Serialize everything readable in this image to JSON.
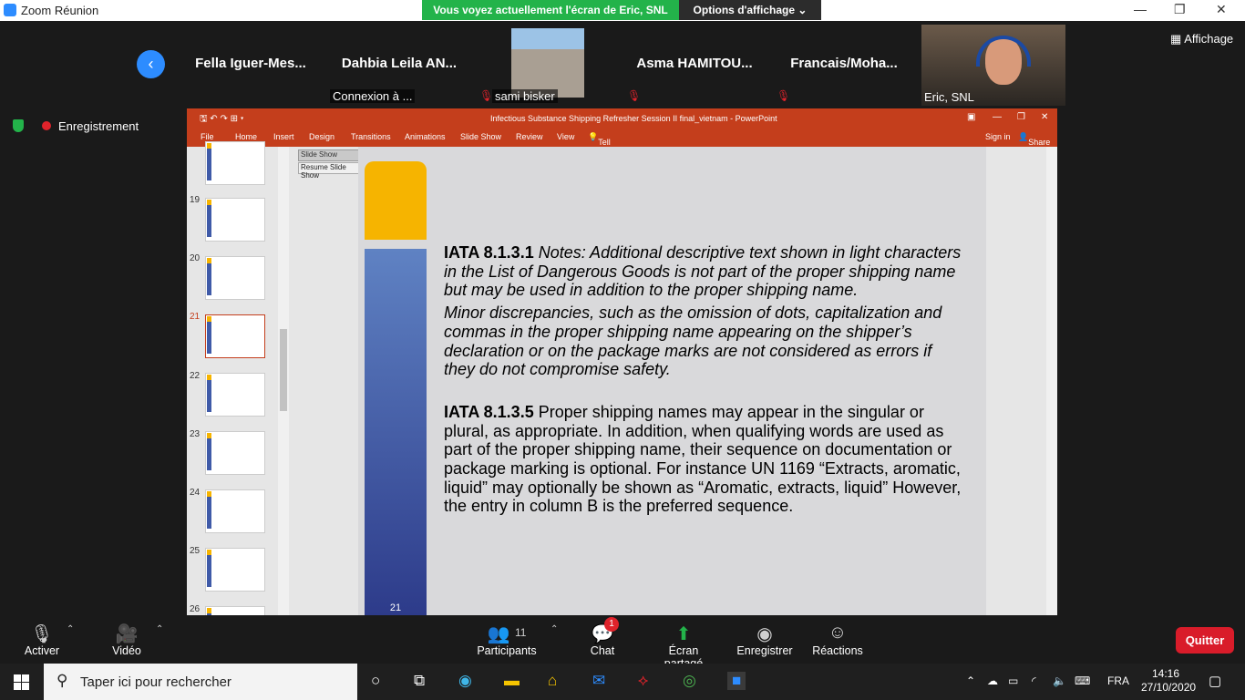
{
  "window": {
    "title": "Zoom Réunion",
    "minimize": "—",
    "maximize": "❐",
    "close": "✕"
  },
  "share_banner": {
    "text": "Vous voyez actuellement l'écran de Eric, SNL",
    "options": "Options d'affichage ⌄"
  },
  "participants_strip": [
    {
      "name": "Fella  Iguer-Mes...",
      "label": "",
      "muted": false
    },
    {
      "name": "Dahbia  Leila  AN...",
      "label": "Connexion à ...",
      "muted": false
    },
    {
      "name": "",
      "label": "sami bisker",
      "muted": true
    },
    {
      "name": "Asma  HAMITOU...",
      "label": "",
      "muted": true
    },
    {
      "name": "Francais/Moha...",
      "label": "",
      "muted": true
    },
    {
      "name": "",
      "label": "Eric, SNL",
      "muted": false
    }
  ],
  "affichage": "Affichage",
  "recording": "Enregistrement",
  "ppt": {
    "title": "Infectious Substance Shipping Refresher Session II final_vietnam - PowerPoint",
    "tabs": [
      "File",
      "Home",
      "Insert",
      "Design",
      "Transitions",
      "Animations",
      "Slide Show",
      "Review",
      "View",
      "Tell me what you want to do..."
    ],
    "sign_in": "Sign in",
    "share": "Share",
    "slideshow_menu": "Slide Show",
    "resume": "Resume Slide Show",
    "thumbnail_numbers": [
      "19",
      "20",
      "21",
      "22",
      "23",
      "24",
      "25",
      "26"
    ],
    "slide_number": "21",
    "p1_bold": "IATA 8.1.3.1",
    "p1_italic": " Notes: Additional descriptive text shown in light characters in the List of Dangerous Goods is not part of the proper shipping name but may be used in addition to the proper shipping name.",
    "p2_italic": "Minor discrepancies, such as the omission of dots, capitalization and commas in the proper shipping name appearing on the shipper’s declaration or on the package marks are not considered as errors if they do not compromise safety.",
    "p3_bold": "IATA 8.1.3.5",
    "p3_text": " Proper shipping names may appear in the singular or plural, as appropriate. In addition, when qualifying words are used as part of the proper shipping name, their sequence on documentation or package marking is optional. For instance UN 1169 “Extracts, aromatic, liquid” may optionally be shown as “Aromatic, extracts, liquid” However, the entry in column B is the preferred sequence."
  },
  "toolbar": {
    "mute": "Activer",
    "video": "Vidéo",
    "participants": "Participants",
    "participants_count": "11",
    "chat": "Chat",
    "chat_badge": "1",
    "share": "Écran partagé",
    "record": "Enregistrer",
    "reactions": "Réactions",
    "quit": "Quitter"
  },
  "taskbar": {
    "search_placeholder": "Taper ici pour rechercher",
    "lang": "FRA",
    "time": "14:16",
    "date": "27/10/2020"
  }
}
